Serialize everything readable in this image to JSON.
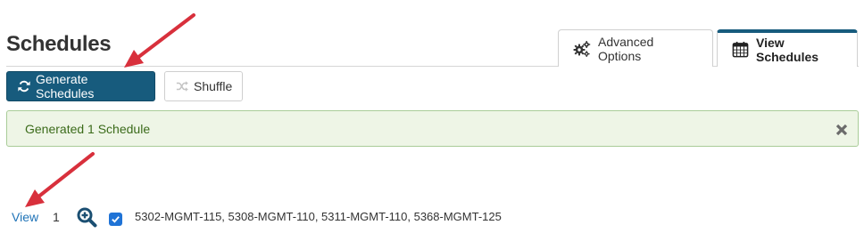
{
  "page": {
    "title": "Schedules"
  },
  "tabs": [
    {
      "label": "Advanced Options",
      "icon": "gears-icon",
      "active": false
    },
    {
      "label": "View Schedules",
      "icon": "calendar-icon",
      "active": true
    }
  ],
  "toolbar": {
    "generate_label": "Generate Schedules",
    "generate_icon": "refresh-icon",
    "shuffle_label": "Shuffle",
    "shuffle_icon": "shuffle-icon"
  },
  "alert": {
    "message": "Generated 1 Schedule",
    "close_icon": "close-icon"
  },
  "schedules": [
    {
      "view_label": "View",
      "index": "1",
      "zoom_icon": "zoom-in-icon",
      "selected": true,
      "sections": "5302-MGMT-115, 5308-MGMT-110, 5311-MGMT-110, 5368-MGMT-125"
    }
  ],
  "annotations": {
    "arrow_color": "#d8303c"
  },
  "colors": {
    "primary": "#175b7d",
    "link": "#1f73b7",
    "alert_bg": "#eef5e6",
    "alert_text": "#3b6b1a",
    "checkbox": "#1f73d6"
  }
}
